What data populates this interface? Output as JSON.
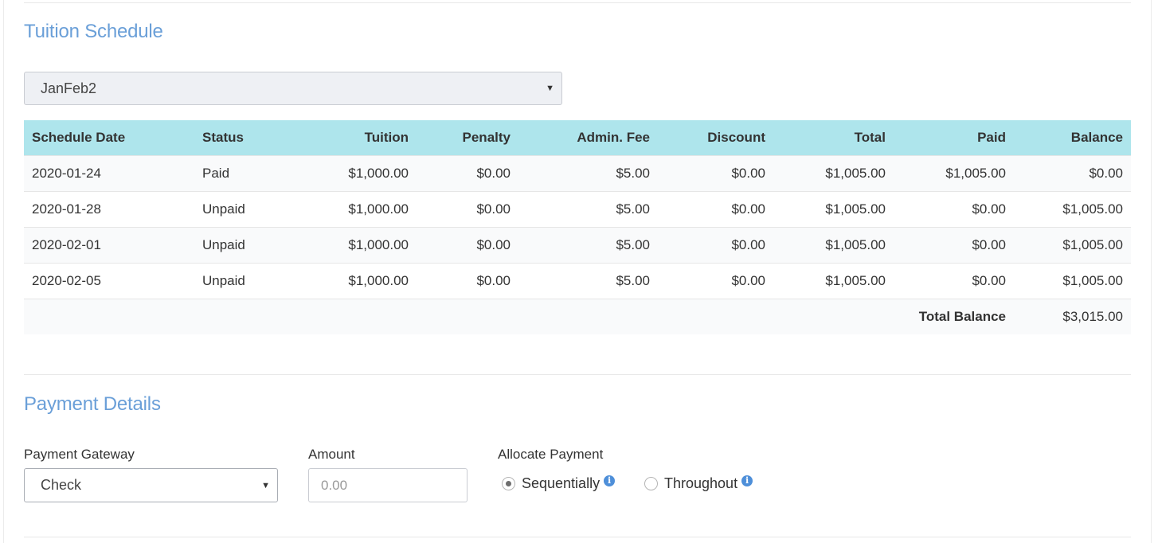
{
  "tuition": {
    "title": "Tuition Schedule",
    "schedule_select": "JanFeb2",
    "columns": [
      "Schedule Date",
      "Status",
      "Tuition",
      "Penalty",
      "Admin. Fee",
      "Discount",
      "Total",
      "Paid",
      "Balance"
    ],
    "rows": [
      [
        "2020-01-24",
        "Paid",
        "$1,000.00",
        "$0.00",
        "$5.00",
        "$0.00",
        "$1,005.00",
        "$1,005.00",
        "$0.00"
      ],
      [
        "2020-01-28",
        "Unpaid",
        "$1,000.00",
        "$0.00",
        "$5.00",
        "$0.00",
        "$1,005.00",
        "$0.00",
        "$1,005.00"
      ],
      [
        "2020-02-01",
        "Unpaid",
        "$1,000.00",
        "$0.00",
        "$5.00",
        "$0.00",
        "$1,005.00",
        "$0.00",
        "$1,005.00"
      ],
      [
        "2020-02-05",
        "Unpaid",
        "$1,000.00",
        "$0.00",
        "$5.00",
        "$0.00",
        "$1,005.00",
        "$0.00",
        "$1,005.00"
      ]
    ],
    "total_balance_label": "Total Balance",
    "total_balance_value": "$3,015.00"
  },
  "payment": {
    "title": "Payment Details",
    "gateway_label": "Payment Gateway",
    "gateway_value": "Check",
    "amount_label": "Amount",
    "amount_placeholder": "0.00",
    "allocate_label": "Allocate Payment",
    "option_sequential": "Sequentially",
    "option_throughout": "Throughout",
    "selected_option": "Sequentially"
  },
  "colors": {
    "accent_title": "#6a9fd8",
    "table_header": "#aee5ec",
    "info_icon": "#4e8fd9"
  }
}
